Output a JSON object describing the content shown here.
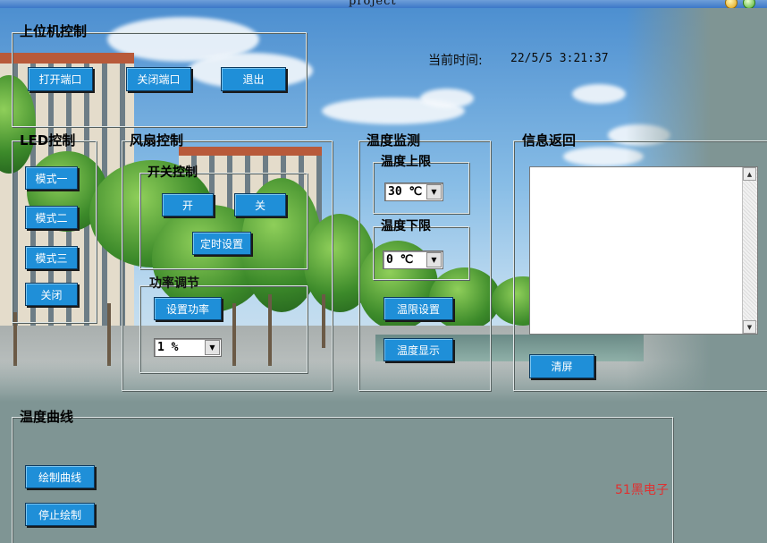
{
  "window": {
    "title": "project"
  },
  "time": {
    "label": "当前时间:",
    "value": "22/5/5 3:21:37"
  },
  "host_control": {
    "title": "上位机控制",
    "open_port": "打开端口",
    "close_port": "关闭端口",
    "exit": "退出"
  },
  "led_control": {
    "title": "LED控制",
    "mode1": "模式一",
    "mode2": "模式二",
    "mode3": "模式三",
    "off": "关闭"
  },
  "fan_control": {
    "title": "风扇控制",
    "switch_title": "开关控制",
    "on": "开",
    "off": "关",
    "timer": "定时设置",
    "power_title": "功率调节",
    "set_power": "设置功率",
    "power_value": "1 %"
  },
  "temp_monitor": {
    "title": "温度监测",
    "upper_title": "温度上限",
    "upper_value": "30 ℃",
    "lower_title": "温度下限",
    "lower_value": "0 ℃",
    "set_limits": "温限设置",
    "show_temp": "温度显示"
  },
  "info_return": {
    "title": "信息返回",
    "clear": "清屏"
  },
  "temp_curve": {
    "title": "温度曲线",
    "draw": "绘制曲线",
    "stop": "停止绘制"
  },
  "brand": "51黑电子",
  "colors": {
    "button": "#1f8fd8",
    "background": "#7f9594",
    "brand_text": "#e03030"
  }
}
